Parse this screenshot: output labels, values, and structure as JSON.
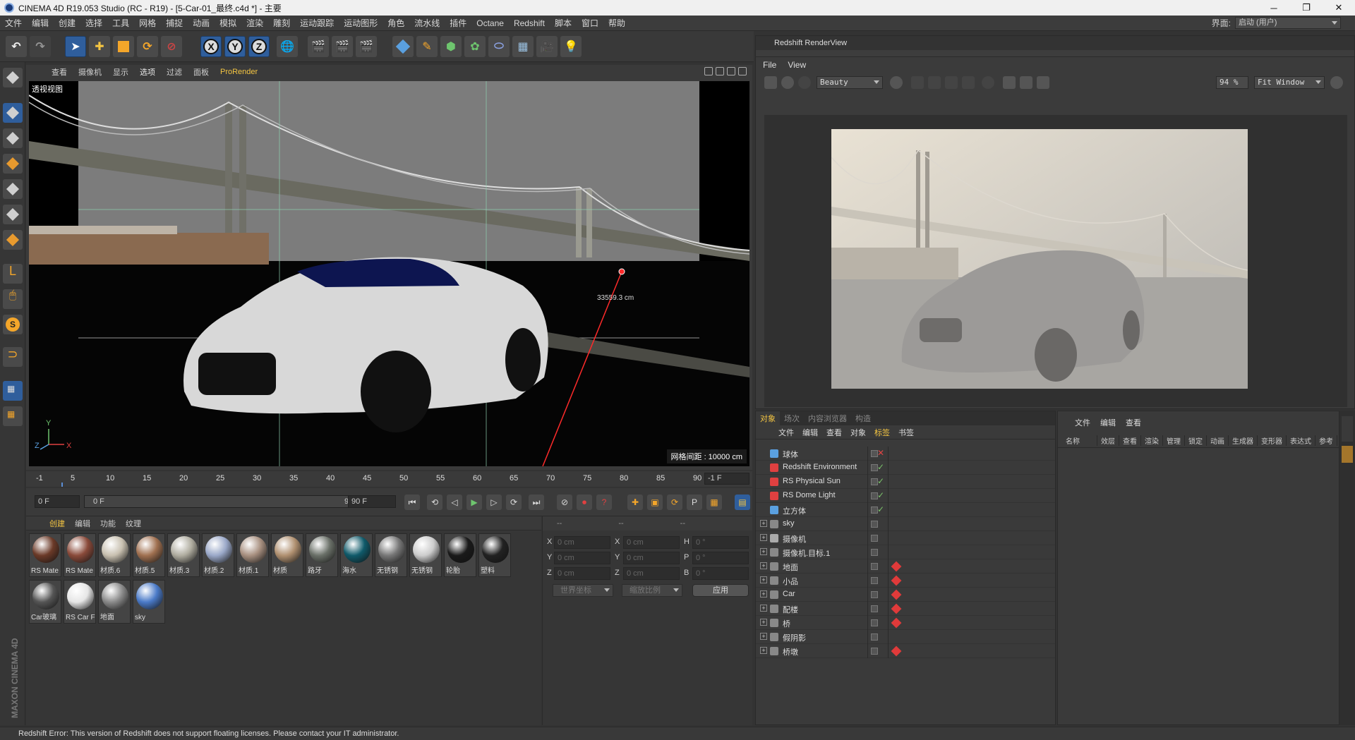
{
  "window": {
    "title": "CINEMA 4D R19.053 Studio (RC - R19) - [5-Car-01_最终.c4d *] - 主要",
    "controls": [
      "─",
      "❐",
      "✕"
    ]
  },
  "menubar": {
    "items": [
      "文件",
      "编辑",
      "创建",
      "选择",
      "工具",
      "网格",
      "捕捉",
      "动画",
      "模拟",
      "渲染",
      "雕刻",
      "运动跟踪",
      "运动图形",
      "角色",
      "流水线",
      "插件",
      "Octane",
      "Redshift",
      "脚本",
      "窗口",
      "帮助"
    ],
    "layout_label": "界面:",
    "layout_value": "启动 (用户)"
  },
  "toolbar": {
    "axis_x": "X",
    "axis_y": "Y",
    "axis_z": "Z"
  },
  "viewport": {
    "menu": [
      "查看",
      "摄像机",
      "显示",
      "选项",
      "过滤",
      "面板"
    ],
    "prorender": "ProRender",
    "label": "透视视图",
    "grid_spacing": "网格间距 : 10000 cm",
    "distance": "33559.3 cm",
    "axis_y": "Y",
    "axis_z": "Z",
    "axis_x": "X"
  },
  "timeline": {
    "ticks": [
      "-1",
      "5",
      "10",
      "15",
      "20",
      "25",
      "30",
      "35",
      "40",
      "45",
      "50",
      "55",
      "60",
      "65",
      "70",
      "75",
      "80",
      "85",
      "90"
    ],
    "end_frame": "-1 F"
  },
  "transport": {
    "start": "0 F",
    "range_start": "0 F",
    "range_end": "90 F",
    "end": "90 F"
  },
  "materials": {
    "menu": [
      "创建",
      "编辑",
      "功能",
      "纹理"
    ],
    "items": [
      {
        "name": "RS Mate",
        "color": "#6b3a28"
      },
      {
        "name": "RS Mate",
        "color": "#8a4a3a"
      },
      {
        "name": "材质.6",
        "color": "#c8c0b0"
      },
      {
        "name": "材质.5",
        "color": "#a07050"
      },
      {
        "name": "材质.3",
        "color": "#b0ada0"
      },
      {
        "name": "材质.2",
        "color": "#9aa8c8"
      },
      {
        "name": "材质.1",
        "color": "#a89080"
      },
      {
        "name": "材质",
        "color": "#b09070"
      },
      {
        "name": "路牙",
        "color": "#6a7068"
      },
      {
        "name": "海水",
        "color": "#0f5a6a"
      },
      {
        "name": "无锈钢",
        "color": "#777777"
      },
      {
        "name": "无锈钢",
        "color": "#cccccc"
      },
      {
        "name": "轮胎",
        "color": "#1a1a1a"
      },
      {
        "name": "塑料",
        "color": "#222222"
      },
      {
        "name": "Car玻璃",
        "color": "#555555"
      },
      {
        "name": "RS Car F",
        "color": "#e6e6e6"
      },
      {
        "name": "地面",
        "color": "#8a8a8a"
      },
      {
        "name": "sky",
        "color": "#4a7ac8"
      }
    ]
  },
  "coords": {
    "headers": [
      "--",
      "--",
      "--"
    ],
    "rows": [
      {
        "a": "X",
        "av": "0 cm",
        "b": "X",
        "bv": "0 cm",
        "c": "H",
        "cv": "0 °"
      },
      {
        "a": "Y",
        "av": "0 cm",
        "b": "Y",
        "bv": "0 cm",
        "c": "P",
        "cv": "0 °"
      },
      {
        "a": "Z",
        "av": "0 cm",
        "b": "Z",
        "bv": "0 cm",
        "c": "B",
        "cv": "0 °"
      }
    ],
    "world": "世界坐标",
    "scale": "缩放比例",
    "apply": "应用"
  },
  "renderview": {
    "title": "Redshift RenderView",
    "menu": [
      "File",
      "View"
    ],
    "aov": "Beauty",
    "zoom": "94 %",
    "fit": "Fit Window"
  },
  "objmgr": {
    "tabs": [
      "对象",
      "场次",
      "内容浏览器",
      "构造"
    ],
    "menu": [
      "文件",
      "编辑",
      "查看",
      "对象",
      "标签",
      "书签"
    ],
    "rows": [
      {
        "name": "球体",
        "icon": "#5aa0e0",
        "state": "cross"
      },
      {
        "name": "Redshift Environment",
        "icon": "#e04040",
        "state": "check"
      },
      {
        "name": "RS Physical Sun",
        "icon": "#e04040",
        "state": "check"
      },
      {
        "name": "RS Dome Light",
        "icon": "#e04040",
        "state": "check"
      },
      {
        "name": "立方体",
        "icon": "#5aa0e0",
        "state": "check"
      },
      {
        "name": "sky",
        "icon": "#888888",
        "state": "none"
      },
      {
        "name": "摄像机",
        "icon": "#aaaaaa",
        "state": "none"
      },
      {
        "name": "摄像机.目标.1",
        "icon": "#888888",
        "state": "none"
      },
      {
        "name": "地面",
        "icon": "#888888",
        "state": "none"
      },
      {
        "name": "小品",
        "icon": "#888888",
        "state": "none"
      },
      {
        "name": "Car",
        "icon": "#888888",
        "state": "none"
      },
      {
        "name": "配楼",
        "icon": "#888888",
        "state": "none"
      },
      {
        "name": "桥",
        "icon": "#888888",
        "state": "none"
      },
      {
        "name": "假阴影",
        "icon": "#888888",
        "state": "none"
      },
      {
        "name": "桥墩",
        "icon": "#888888",
        "state": "none"
      }
    ]
  },
  "attrmgr": {
    "menu": [
      "文件",
      "编辑",
      "查看"
    ],
    "columns": [
      "名称",
      "效层",
      "查看",
      "渲染",
      "管理",
      "锁定",
      "动画",
      "生成器",
      "变形器",
      "表达式",
      "参考"
    ]
  },
  "status": "Redshift Error: This version of Redshift does not support floating licenses. Please contact your IT administrator."
}
